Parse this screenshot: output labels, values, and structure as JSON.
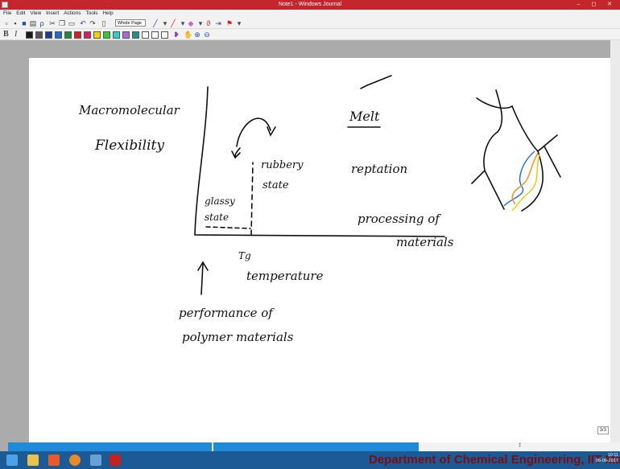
{
  "window": {
    "title": "Note1 - Windows Journal",
    "controls": "– ◻ ✕"
  },
  "menu": [
    "File",
    "Edit",
    "View",
    "Insert",
    "Actions",
    "Tools",
    "Help"
  ],
  "toolbar": {
    "zoom_dropdown": "Whole Page"
  },
  "palette": [
    "#1a1a1a",
    "#555555",
    "#1f3d8c",
    "#1e6dd6",
    "#1e8c3a",
    "#d61e1e",
    "#d61e66",
    "#f2d500",
    "#33cc33",
    "#33cccc",
    "#aa66dd",
    "#1e8f8f",
    "#ffffff",
    "#ffffff",
    "#ffffff"
  ],
  "note": {
    "left_title_1": "Macromolecular",
    "left_title_2": "Flexibility",
    "glassy_1": "glassy",
    "glassy_2": "state",
    "rubbery_1": "rubbery",
    "rubbery_2": "state",
    "tg": "Tg",
    "temperature": "temperature",
    "performance_1": "performance of",
    "performance_2": "polymer materials",
    "melt": "Melt",
    "reptation": "reptation",
    "processing_1": "processing of",
    "processing_2": "materials"
  },
  "status": {
    "page_indicator": "3/3",
    "center_mark": "‡"
  },
  "footer": {
    "institution": "Department of Chemical Engineering, IIT Madras"
  },
  "clock": {
    "time": "10:11",
    "date": "06-06-2017"
  }
}
